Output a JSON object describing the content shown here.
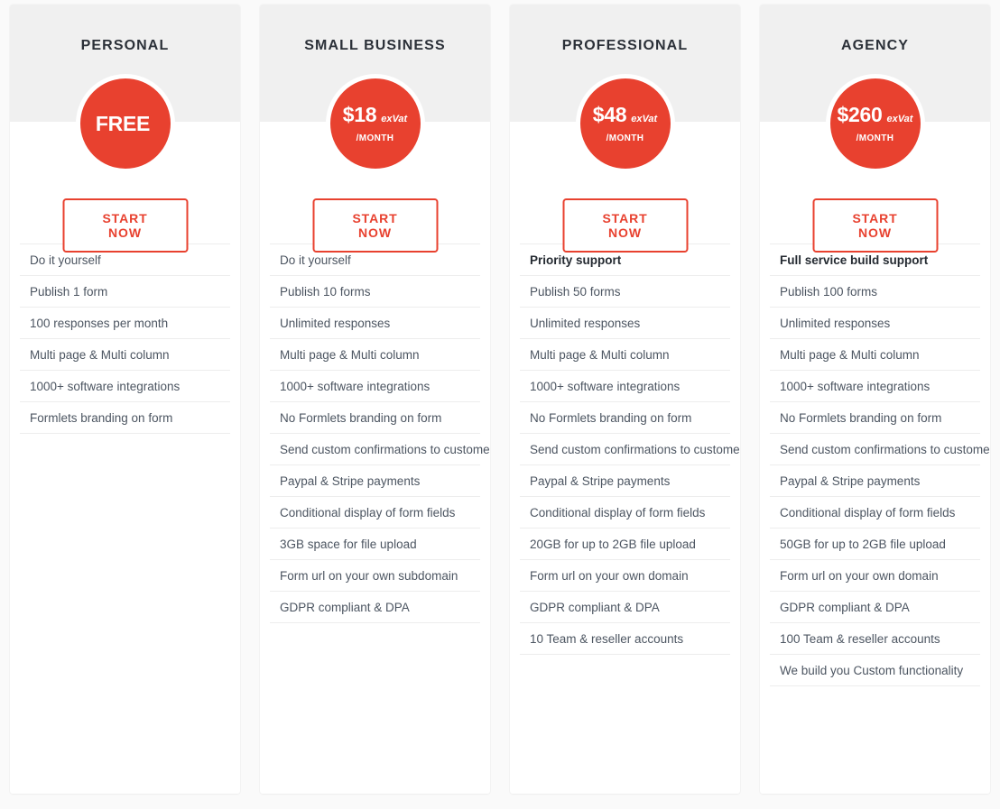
{
  "colors": {
    "accent": "#e8412f",
    "page_background": "#fafafa",
    "card_background": "#ffffff",
    "header_band": "#f0f0f0",
    "feature_text": "#4c5561",
    "heading_text": "#2b3038",
    "divider": "#ededed"
  },
  "plans": [
    {
      "name": "PERSONAL",
      "price_amount": "FREE",
      "price_vat": "",
      "price_period": "",
      "cta_label": "START NOW",
      "features": [
        {
          "text": "Do it yourself",
          "highlight": false
        },
        {
          "text": "Publish 1 form",
          "highlight": false
        },
        {
          "text": "100 responses per month",
          "highlight": false
        },
        {
          "text": "Multi page & Multi column",
          "highlight": false
        },
        {
          "text": "1000+ software integrations",
          "highlight": false
        },
        {
          "text": "Formlets branding on form",
          "highlight": false
        }
      ]
    },
    {
      "name": "SMALL BUSINESS",
      "price_amount": "$18",
      "price_vat": "exVat",
      "price_period": "/MONTH",
      "cta_label": "START NOW",
      "features": [
        {
          "text": "Do it yourself",
          "highlight": false
        },
        {
          "text": "Publish 10 forms",
          "highlight": false
        },
        {
          "text": "Unlimited responses",
          "highlight": false
        },
        {
          "text": "Multi page & Multi column",
          "highlight": false
        },
        {
          "text": "1000+ software integrations",
          "highlight": false
        },
        {
          "text": "No Formlets branding on form",
          "highlight": false
        },
        {
          "text": "Send custom confirmations to customers",
          "highlight": false
        },
        {
          "text": "Paypal & Stripe payments",
          "highlight": false
        },
        {
          "text": "Conditional display of form fields",
          "highlight": false
        },
        {
          "text": "3GB space for file upload",
          "highlight": false
        },
        {
          "text": "Form url on your own subdomain",
          "highlight": false
        },
        {
          "text": "GDPR compliant & DPA",
          "highlight": false
        }
      ]
    },
    {
      "name": "PROFESSIONAL",
      "price_amount": "$48",
      "price_vat": "exVat",
      "price_period": "/MONTH",
      "cta_label": "START NOW",
      "features": [
        {
          "text": "Priority support",
          "highlight": true
        },
        {
          "text": "Publish 50 forms",
          "highlight": false
        },
        {
          "text": "Unlimited responses",
          "highlight": false
        },
        {
          "text": "Multi page & Multi column",
          "highlight": false
        },
        {
          "text": "1000+ software integrations",
          "highlight": false
        },
        {
          "text": "No Formlets branding on form",
          "highlight": false
        },
        {
          "text": "Send custom confirmations to customers",
          "highlight": false
        },
        {
          "text": "Paypal & Stripe payments",
          "highlight": false
        },
        {
          "text": "Conditional display of form fields",
          "highlight": false
        },
        {
          "text": "20GB for up to 2GB file upload",
          "highlight": false
        },
        {
          "text": "Form url on your own domain",
          "highlight": false
        },
        {
          "text": "GDPR compliant & DPA",
          "highlight": false
        },
        {
          "text": "10 Team & reseller accounts",
          "highlight": false
        }
      ]
    },
    {
      "name": "AGENCY",
      "price_amount": "$260",
      "price_vat": "exVat",
      "price_period": "/MONTH",
      "cta_label": "START NOW",
      "features": [
        {
          "text": "Full service build support",
          "highlight": true
        },
        {
          "text": "Publish 100 forms",
          "highlight": false
        },
        {
          "text": "Unlimited responses",
          "highlight": false
        },
        {
          "text": "Multi page & Multi column",
          "highlight": false
        },
        {
          "text": "1000+ software integrations",
          "highlight": false
        },
        {
          "text": "No Formlets branding on form",
          "highlight": false
        },
        {
          "text": "Send custom confirmations to customers",
          "highlight": false
        },
        {
          "text": "Paypal & Stripe payments",
          "highlight": false
        },
        {
          "text": "Conditional display of form fields",
          "highlight": false
        },
        {
          "text": "50GB for up to 2GB file upload",
          "highlight": false
        },
        {
          "text": "Form url on your own domain",
          "highlight": false
        },
        {
          "text": "GDPR compliant & DPA",
          "highlight": false
        },
        {
          "text": "100 Team & reseller accounts",
          "highlight": false
        },
        {
          "text": "We build you Custom functionality",
          "highlight": false
        }
      ]
    }
  ]
}
